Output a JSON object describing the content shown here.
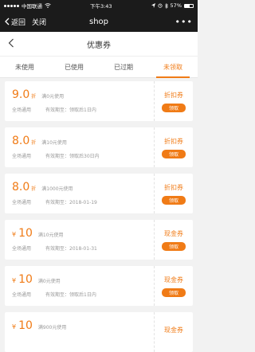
{
  "status_bar": {
    "carrier": "中国联通",
    "time": "下午3:43",
    "battery": "57%",
    "battery_level": 0.57
  },
  "wechat_bar": {
    "back_label": "返回",
    "close_label": "关闭",
    "title": "shop",
    "more": "•••"
  },
  "page": {
    "title": "优惠券"
  },
  "tabs": [
    {
      "label": "未使用"
    },
    {
      "label": "已使用"
    },
    {
      "label": "已过期"
    },
    {
      "label": "未领取"
    }
  ],
  "coupons": [
    {
      "amount": "9.0",
      "unit": "折",
      "condition": "满0元使用",
      "scope": "全场通用",
      "validity": "有效期至：领取后1日内",
      "type": "折扣券",
      "button": "领取"
    },
    {
      "amount": "8.0",
      "unit": "折",
      "condition": "满10元使用",
      "scope": "全场通用",
      "validity": "有效期至：领取后30日内",
      "type": "折扣券",
      "button": "领取"
    },
    {
      "amount": "8.0",
      "unit": "折",
      "condition": "满1000元使用",
      "scope": "全场通用",
      "validity": "有效期至：2018-01-19",
      "type": "折扣券",
      "button": "领取"
    },
    {
      "currency": "¥",
      "amount": "10",
      "condition": "满10元使用",
      "scope": "全场通用",
      "validity": "有效期至：2018-01-31",
      "type": "现金券",
      "button": "领取"
    },
    {
      "currency": "¥",
      "amount": "10",
      "condition": "满0元使用",
      "scope": "全场通用",
      "validity": "有效期至：领取后1日内",
      "type": "现金券",
      "button": "领取"
    },
    {
      "currency": "¥",
      "amount": "10",
      "condition": "满900元使用",
      "type": "现金券"
    }
  ],
  "colors": {
    "accent": "#f07b16",
    "header_bg": "#1b1b1b",
    "page_bg": "#f2f2f2"
  }
}
